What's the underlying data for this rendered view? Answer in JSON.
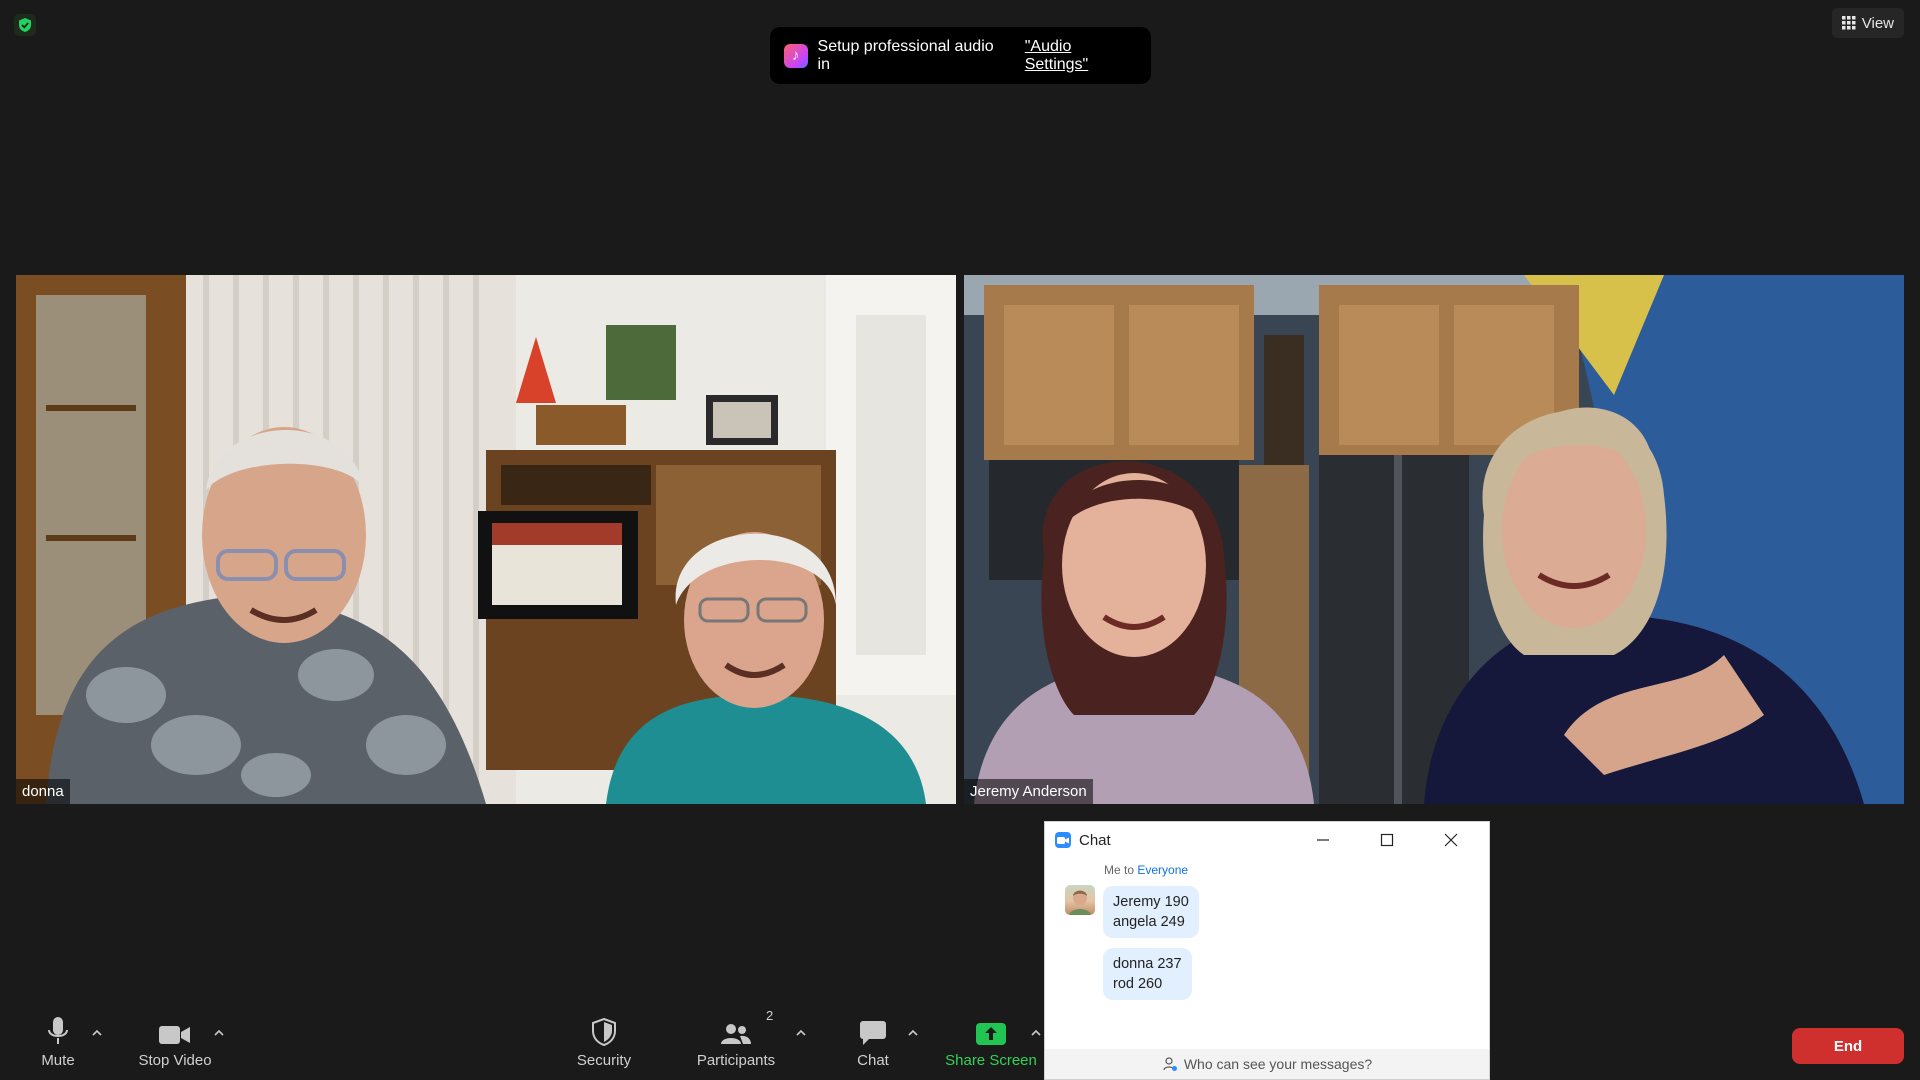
{
  "toast": {
    "text": "Setup professional audio in",
    "link": "\"Audio Settings\""
  },
  "view_button": {
    "label": "View"
  },
  "participants": [
    {
      "name": "donna"
    },
    {
      "name": "Jeremy Anderson"
    }
  ],
  "chat": {
    "title": "Chat",
    "meta_from": "Me to",
    "meta_to": "Everyone",
    "messages": [
      {
        "line1": "Jeremy 190",
        "line2": "angela 249"
      },
      {
        "line1": "donna 237",
        "line2": "rod 260"
      }
    ],
    "footer": "Who can see your messages?"
  },
  "toolbar": {
    "mute": "Mute",
    "stop_video": "Stop Video",
    "security": "Security",
    "participants": "Participants",
    "participants_count": "2",
    "chat": "Chat",
    "share_screen": "Share Screen",
    "end": "End"
  },
  "colors": {
    "background": "#1a1a1a",
    "end_button": "#d0302d",
    "share_green": "#34d058",
    "bubble": "#e1efff",
    "link_blue": "#0e71eb"
  }
}
